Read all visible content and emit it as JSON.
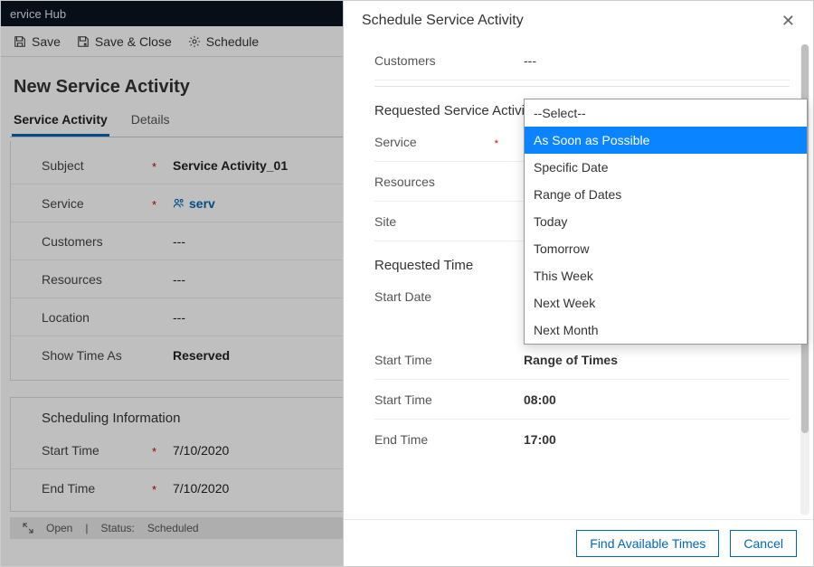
{
  "app": {
    "title": "ervice Hub"
  },
  "commands": {
    "save": "Save",
    "save_close": "Save & Close",
    "schedule": "Schedule"
  },
  "form": {
    "title": "New Service Activity",
    "tabs": {
      "activity": "Service Activity",
      "details": "Details"
    },
    "fields": {
      "subject": {
        "label": "Subject",
        "value": "Service Activity_01"
      },
      "service": {
        "label": "Service",
        "value": "serv"
      },
      "customers": {
        "label": "Customers",
        "value": "---"
      },
      "resources": {
        "label": "Resources",
        "value": "---"
      },
      "location": {
        "label": "Location",
        "value": "---"
      },
      "show_time_as": {
        "label": "Show Time As",
        "value": "Reserved"
      }
    },
    "scheduling": {
      "header": "Scheduling Information",
      "start": {
        "label": "Start Time",
        "value": "7/10/2020"
      },
      "end": {
        "label": "End Time",
        "value": "7/10/2020"
      }
    }
  },
  "statusbar": {
    "open": "Open",
    "status_label": "Status:",
    "status_value": "Scheduled"
  },
  "modal": {
    "title": "Schedule Service Activity",
    "customers": {
      "label": "Customers",
      "value": "---"
    },
    "reqactivity_header": "Requested Service Activi",
    "service": {
      "label": "Service",
      "value": ""
    },
    "resources": {
      "label": "Resources",
      "value": ""
    },
    "site": {
      "label": "Site",
      "value": ""
    },
    "reqtime_header": "Requested Time",
    "start_date": {
      "label": "Start Date",
      "value": "As Soon as Possible"
    },
    "start_time_type": {
      "label": "Start Time",
      "value": "Range of Times"
    },
    "start_time": {
      "label": "Start Time",
      "value": "08:00"
    },
    "end_time": {
      "label": "End Time",
      "value": "17:00"
    },
    "dropdown": {
      "placeholder": "--Select--",
      "options": [
        "As Soon as Possible",
        "Specific Date",
        "Range of Dates",
        "Today",
        "Tomorrow",
        "This Week",
        "Next Week",
        "Next Month"
      ],
      "selected_index": 0
    },
    "buttons": {
      "find": "Find Available Times",
      "cancel": "Cancel"
    }
  }
}
